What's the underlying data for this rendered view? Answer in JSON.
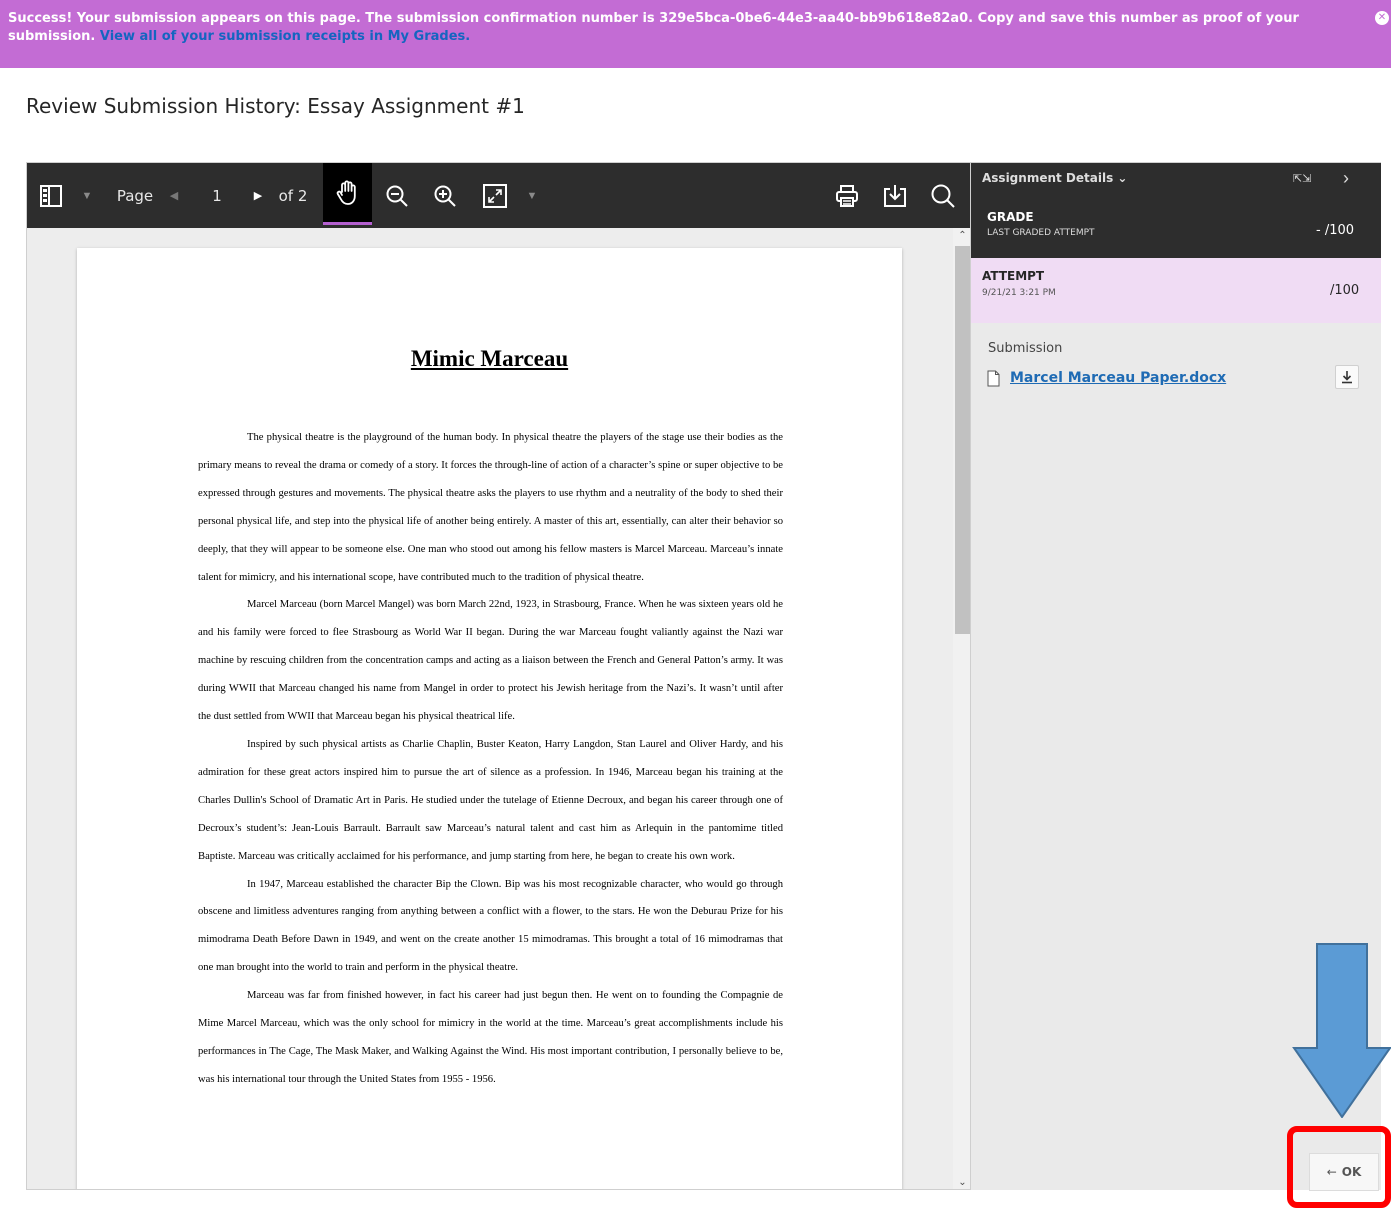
{
  "banner": {
    "message": "Success! Your submission appears on this page. The submission confirmation number is 329e5bca-0be6-44e3-aa40-bb9b618e82a0. Copy and save this number as proof of your submission. ",
    "link": "View all of your submission receipts in My Grades."
  },
  "page": {
    "title": "Review Submission History: Essay Assignment #1"
  },
  "toolbar": {
    "page_label": "Page",
    "page_current": "1",
    "page_total": "of 2"
  },
  "document": {
    "title": "Mimic Marceau",
    "paragraphs": [
      "The physical theatre is the playground of the human body.  In physical theatre the players of the stage use their bodies as the primary means to reveal the drama or comedy of a story.  It forces the through-line of action of a character’s spine or super objective to be expressed through gestures and movements.  The physical theatre asks the players to use rhythm and a neutrality of the body to shed their personal physical life, and step into the physical life of another being entirely.  A master of this art, essentially, can alter their behavior so deeply, that they will appear to be someone else.  One man who stood out among his fellow masters is Marcel Marceau.  Marceau’s innate talent for mimicry, and his international scope, have contributed much to the tradition of physical theatre.",
      "Marcel Marceau (born Marcel Mangel) was born March 22nd, 1923, in Strasbourg, France.  When he was sixteen years old he and his family were forced to flee Strasbourg as World War II began.  During the war Marceau fought valiantly against the Nazi war machine by rescuing children from the concentration camps and acting as a liaison between the French and General Patton’s army.  It was during WWII that Marceau changed his name from Mangel in order to protect his Jewish heritage from the Nazi’s.  It wasn’t until after the dust settled from WWII that Marceau began his physical theatrical life.",
      "Inspired by such physical artists as Charlie Chaplin, Buster Keaton, Harry Langdon, Stan Laurel and Oliver Hardy, and his admiration for these great actors inspired him to pursue the art of silence as a profession.  In 1946, Marceau began his training at the Charles Dullin's School of Dramatic Art in Paris.  He studied under the tutelage of Etienne Decroux, and began his career through one of Decroux’s student’s: Jean-Louis Barrault.  Barrault saw Marceau’s natural talent and cast him as Arlequin in the pantomime titled Baptiste.  Marceau was critically acclaimed for his performance, and jump starting from here, he began to create his own work.",
      "In 1947, Marceau established the character Bip the Clown.  Bip was his most recognizable character, who would go through obscene and limitless adventures ranging from anything between a conflict with a flower, to the stars.  He won the Deburau Prize for his mimodrama Death Before Dawn in 1949, and went on the create another 15 mimodramas.  This brought a total of 16 mimodramas that one man brought into the world to train and perform in the physical theatre.",
      "Marceau was far from finished however, in fact his career had just begun then.  He went on to founding the Compagnie de Mime Marcel Marceau, which was the only school for mimicry in the world at the time. Marceau’s great accomplishments include his performances in The Cage, The Mask Maker, and Walking Against the Wind.  His most important contribution, I personally believe to be, was his international tour through the United States from 1955 - 1956."
    ]
  },
  "panel": {
    "details_label": "Assignment Details",
    "grade_label": "GRADE",
    "grade_sub": "LAST GRADED ATTEMPT",
    "grade_value": "- /100",
    "attempt_label": "ATTEMPT",
    "attempt_date": "9/21/21 3:21 PM",
    "attempt_score": "/100",
    "submission_label": "Submission",
    "file_name": "Marcel Marceau Paper.docx"
  },
  "ok_button": {
    "label": "OK"
  },
  "colors": {
    "banner": "#c36cd4",
    "toolbar": "#2d2d2d",
    "attempt_highlight": "#f0dcf4",
    "link": "#1f6bb4",
    "annotation_arrow": "#5b9bd5",
    "annotation_box": "#ff0000"
  }
}
